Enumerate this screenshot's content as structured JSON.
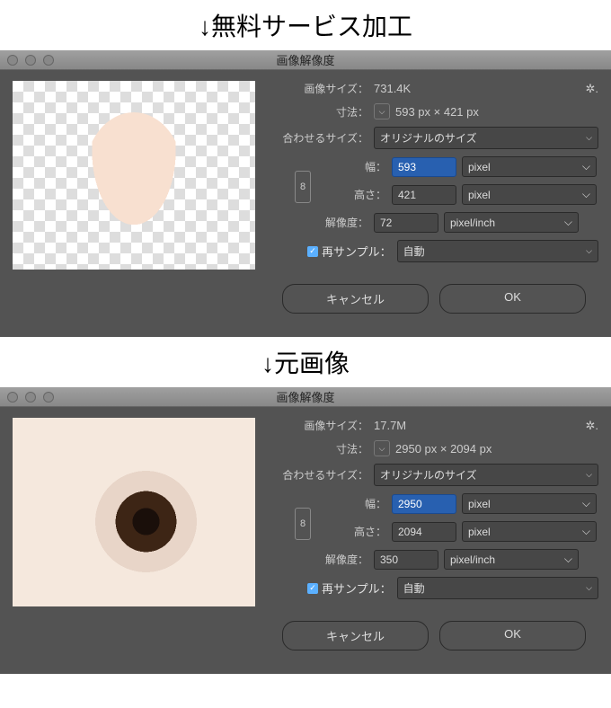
{
  "headers": {
    "free_service": "↓無料サービス加工",
    "original": "↓元画像"
  },
  "common": {
    "dialog_title": "画像解像度",
    "labels": {
      "image_size": "画像サイズ：",
      "dimensions": "寸法：",
      "fit_to": "合わせるサイズ：",
      "width": "幅：",
      "height": "高さ：",
      "resolution": "解像度：",
      "resample": "再サンプル："
    },
    "fit_to_value": "オリジナルのサイズ",
    "width_unit": "pixel",
    "height_unit": "pixel",
    "resolution_unit": "pixel/inch",
    "resample_value": "自動",
    "buttons": {
      "cancel": "キャンセル",
      "ok": "OK"
    }
  },
  "panels": [
    {
      "image_size": "731.4K",
      "dimensions": "593 px × 421 px",
      "width": "593",
      "height": "421",
      "resolution": "72"
    },
    {
      "image_size": "17.7M",
      "dimensions": "2950 px × 2094 px",
      "width": "2950",
      "height": "2094",
      "resolution": "350"
    }
  ]
}
